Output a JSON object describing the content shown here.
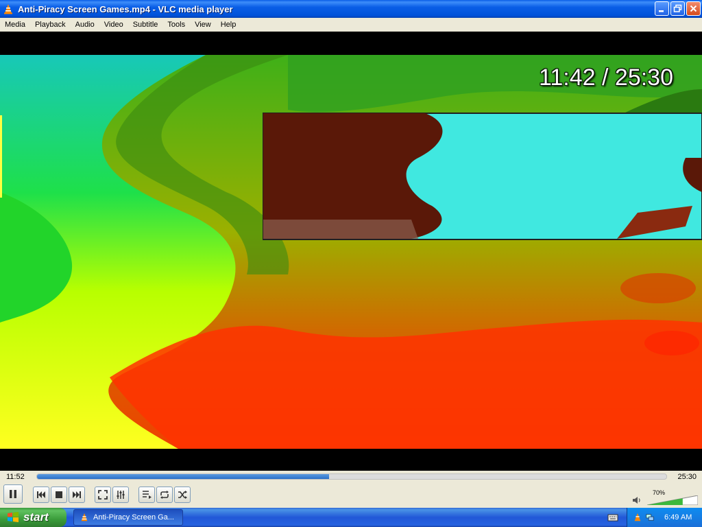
{
  "window": {
    "title": "Anti-Piracy Screen Games.mp4 - VLC media player"
  },
  "menu": [
    "Media",
    "Playback",
    "Audio",
    "Video",
    "Subtitle",
    "Tools",
    "View",
    "Help"
  ],
  "video": {
    "osd_time": "11:42 / 25:30"
  },
  "controls": {
    "elapsed": "11:52",
    "duration": "25:30",
    "progress": 0.464,
    "volume_label": "70%",
    "volume": 0.7
  },
  "taskbar": {
    "start_label": "start",
    "task_label": "Anti-Piracy Screen Ga...",
    "clock": "6:49 AM"
  },
  "icons": {
    "app": "vlc-cone-icon",
    "pause": "pause-icon",
    "previous": "previous-icon",
    "stop": "stop-icon",
    "next": "next-icon",
    "fullscreen": "fullscreen-icon",
    "extended": "extended-settings-icon",
    "playlist": "playlist-icon",
    "loop": "loop-icon",
    "shuffle": "shuffle-icon",
    "volume": "speaker-icon"
  },
  "colors": {
    "titlebar": "#0a5ee6",
    "menubar": "#ece9d8",
    "seek_fill": "#2a70c8",
    "taskbar": "#2157d7",
    "start": "#3a9c3a"
  }
}
